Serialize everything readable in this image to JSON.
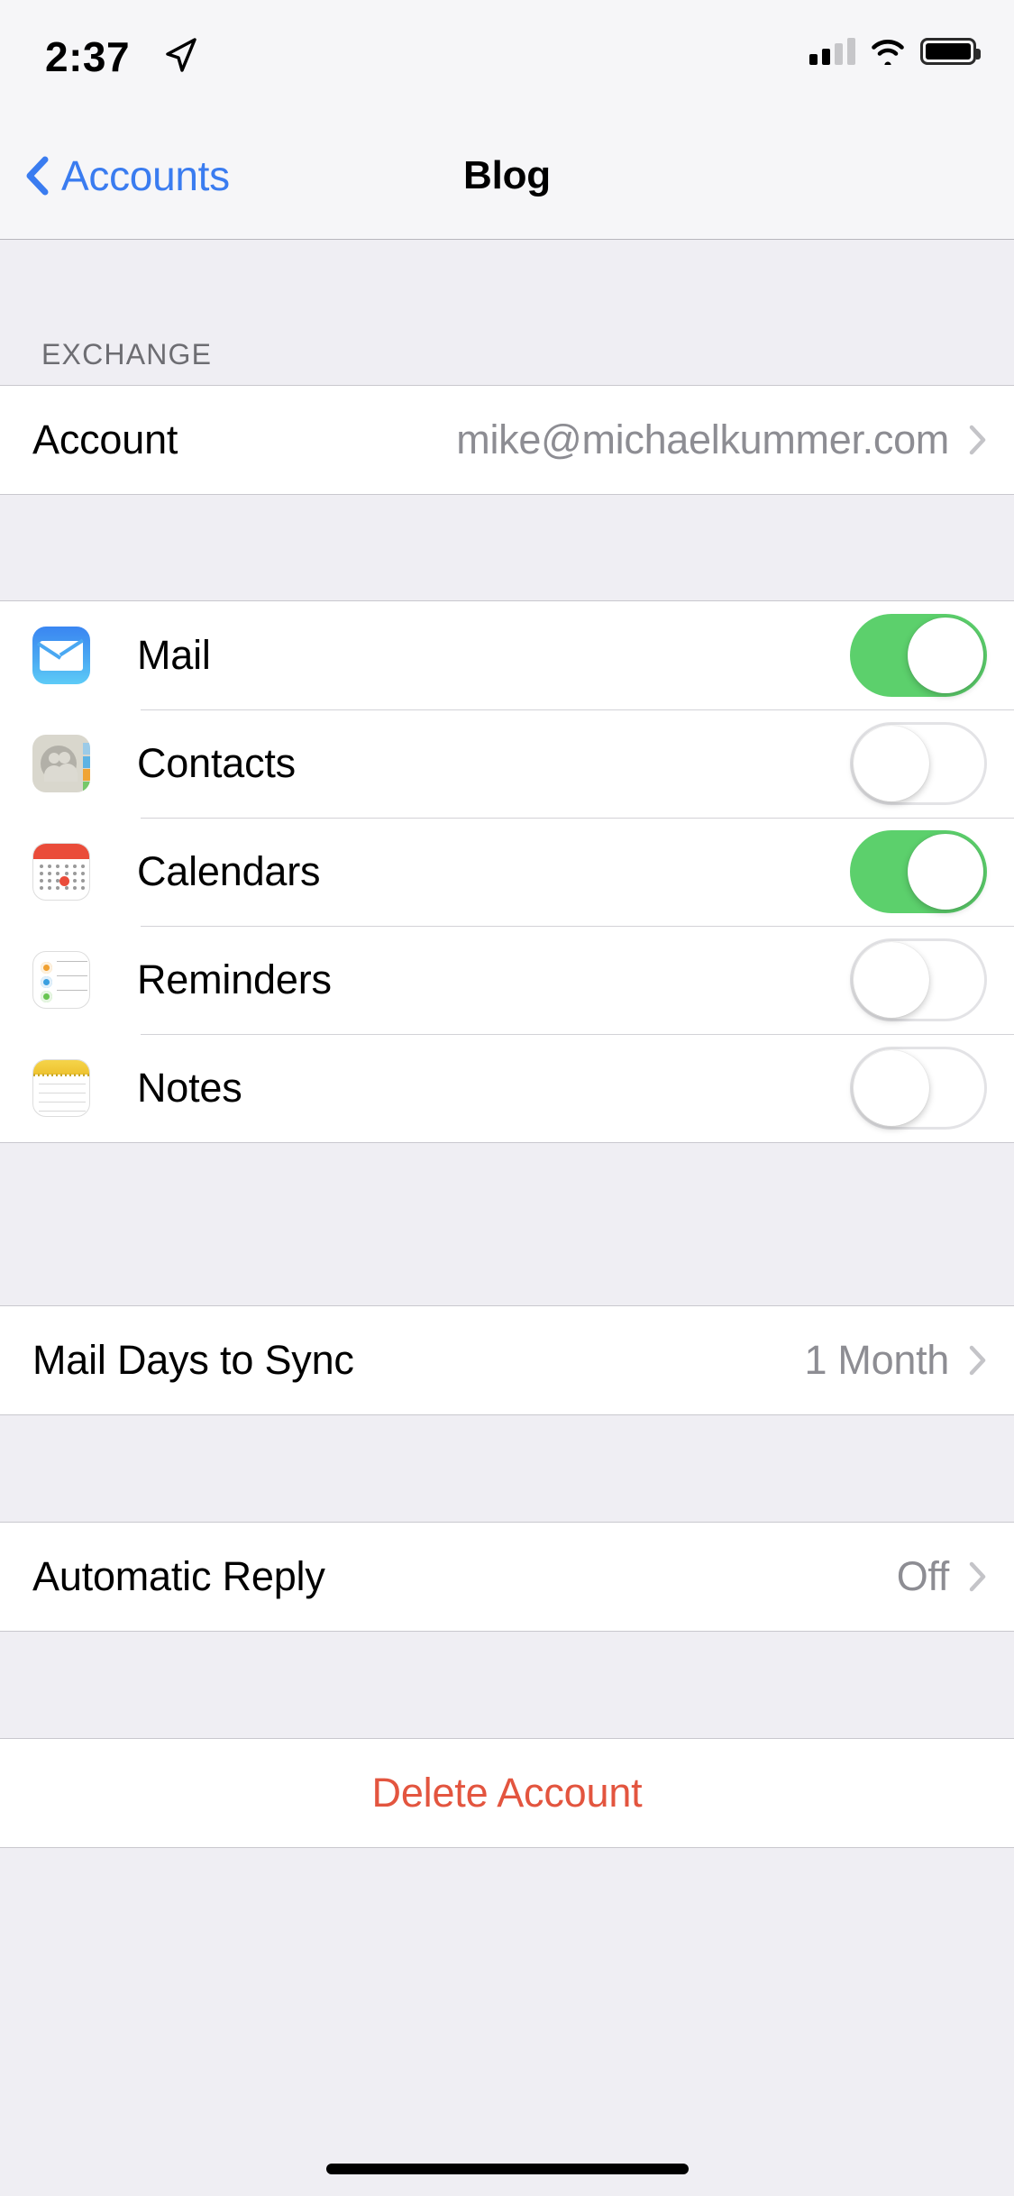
{
  "status_bar": {
    "time": "2:37",
    "location_icon": "location-arrow-icon",
    "signal_icon": "cellular-signal-icon",
    "signal_bars_filled": 2,
    "signal_bars_total": 4,
    "wifi_icon": "wifi-icon",
    "battery_icon": "battery-icon"
  },
  "navbar": {
    "back_label": "Accounts",
    "back_icon": "chevron-left-icon",
    "title": "Blog"
  },
  "sections": {
    "exchange": {
      "header": "EXCHANGE",
      "account_row": {
        "label": "Account",
        "value": "mike@michaelkummer.com",
        "chevron": "chevron-right-icon"
      }
    },
    "services": {
      "rows": [
        {
          "label": "Mail",
          "icon": "mail-app-icon",
          "toggle": "on"
        },
        {
          "label": "Contacts",
          "icon": "contacts-app-icon",
          "toggle": "off"
        },
        {
          "label": "Calendars",
          "icon": "calendar-app-icon",
          "toggle": "on"
        },
        {
          "label": "Reminders",
          "icon": "reminders-app-icon",
          "toggle": "off"
        },
        {
          "label": "Notes",
          "icon": "notes-app-icon",
          "toggle": "off"
        }
      ]
    },
    "sync": {
      "label": "Mail Days to Sync",
      "value": "1 Month",
      "chevron": "chevron-right-icon"
    },
    "auto_reply": {
      "label": "Automatic Reply",
      "value": "Off",
      "chevron": "chevron-right-icon"
    },
    "delete": {
      "label": "Delete Account"
    }
  },
  "colors": {
    "tint_blue": "#3a7cf0",
    "destructive_red": "#e3553f",
    "toggle_green": "#5cd06c",
    "group_background": "#efeef3",
    "row_background": "#ffffff",
    "secondary_text": "#8d8d93"
  }
}
